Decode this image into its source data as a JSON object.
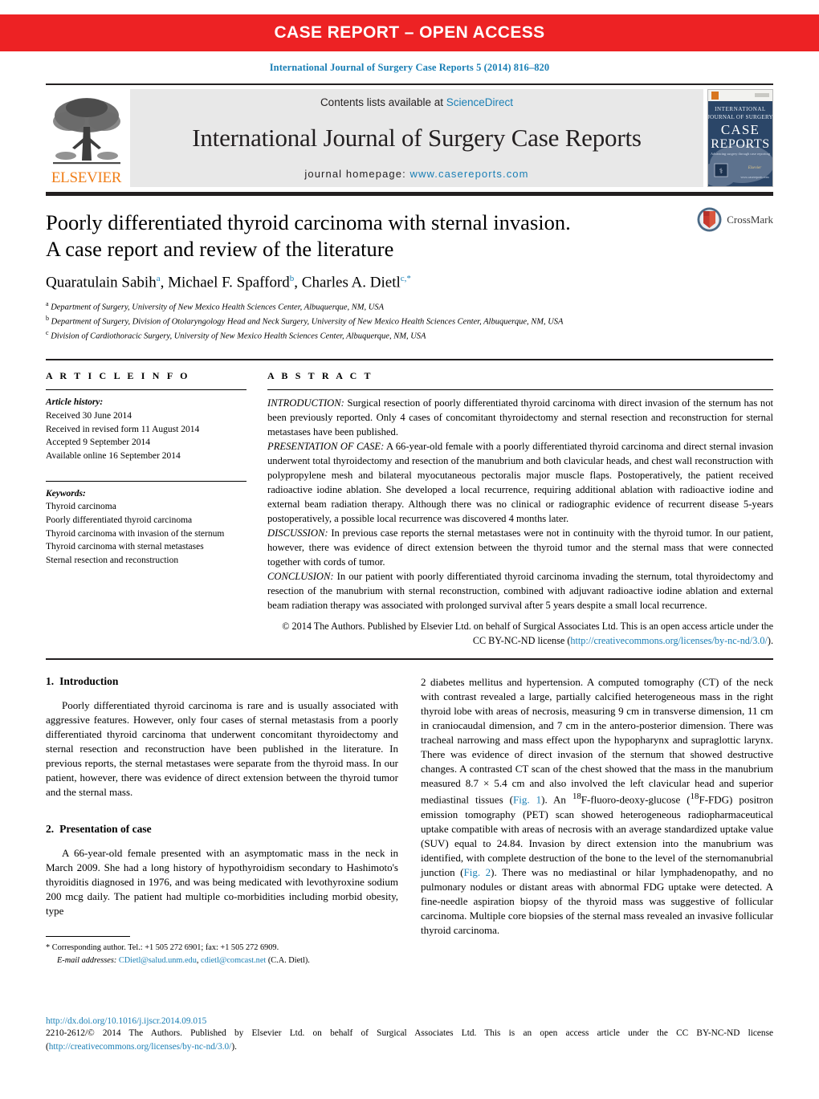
{
  "banner": {
    "text": "CASE REPORT – OPEN ACCESS"
  },
  "citation": {
    "text": "International Journal of Surgery Case Reports 5 (2014) 816–820"
  },
  "masthead": {
    "publisher_logo_text": "ELSEVIER",
    "contents_prefix": "Contents lists available at ",
    "contents_link": "ScienceDirect",
    "journal_title": "International Journal of Surgery Case Reports",
    "homepage_label": "journal homepage:",
    "homepage_url": "www.casereports.com",
    "cover": {
      "line1": "INTERNATIONAL",
      "line2": "JOURNAL OF SURGERY",
      "line3": "CASE",
      "line4": "REPORTS",
      "tagline": "Advancing surgery through case reporting",
      "url": "www.casereports.com"
    }
  },
  "article": {
    "title": "Poorly differentiated thyroid carcinoma with sternal invasion. A case report and review of the literature",
    "title_line1": "Poorly differentiated thyroid carcinoma with sternal invasion.",
    "title_line2": "A case report and review of the literature",
    "authors": [
      {
        "name": "Quaratulain Sabih",
        "marks": "a"
      },
      {
        "name": "Michael F. Spafford",
        "marks": "b"
      },
      {
        "name": "Charles A. Dietl",
        "marks": "c,*"
      }
    ],
    "affiliations": [
      {
        "mark": "a",
        "text": "Department of Surgery, University of New Mexico Health Sciences Center, Albuquerque, NM, USA"
      },
      {
        "mark": "b",
        "text": "Department of Surgery, Division of Otolaryngology Head and Neck Surgery, University of New Mexico Health Sciences Center, Albuquerque, NM, USA"
      },
      {
        "mark": "c",
        "text": "Division of Cardiothoracic Surgery, University of New Mexico Health Sciences Center, Albuquerque, NM, USA"
      }
    ],
    "crossmark_label": "CrossMark"
  },
  "info": {
    "heading": "A R T I C L E   I N F O",
    "history_label": "Article history:",
    "history": [
      "Received 30 June 2014",
      "Received in revised form 11 August 2014",
      "Accepted 9 September 2014",
      "Available online 16 September 2014"
    ],
    "keywords_label": "Keywords:",
    "keywords": [
      "Thyroid carcinoma",
      "Poorly differentiated thyroid carcinoma",
      "Thyroid carcinoma with invasion of the sternum",
      "Thyroid carcinoma with sternal metastases",
      "Sternal resection and reconstruction"
    ]
  },
  "abstract": {
    "heading": "A B S T R A C T",
    "sections": [
      {
        "lead": "INTRODUCTION:",
        "text": " Surgical resection of poorly differentiated thyroid carcinoma with direct invasion of the sternum has not been previously reported. Only 4 cases of concomitant thyroidectomy and sternal resection and reconstruction for sternal metastases have been published."
      },
      {
        "lead": "PRESENTATION OF CASE:",
        "text": " A 66-year-old female with a poorly differentiated thyroid carcinoma and direct sternal invasion underwent total thyroidectomy and resection of the manubrium and both clavicular heads, and chest wall reconstruction with polypropylene mesh and bilateral myocutaneous pectoralis major muscle flaps. Postoperatively, the patient received radioactive iodine ablation. She developed a local recurrence, requiring additional ablation with radioactive iodine and external beam radiation therapy. Although there was no clinical or radiographic evidence of recurrent disease 5-years postoperatively, a possible local recurrence was discovered 4 months later."
      },
      {
        "lead": "DISCUSSION:",
        "text": " In previous case reports the sternal metastases were not in continuity with the thyroid tumor. In our patient, however, there was evidence of direct extension between the thyroid tumor and the sternal mass that were connected together with cords of tumor."
      },
      {
        "lead": "CONCLUSION:",
        "text": " In our patient with poorly differentiated thyroid carcinoma invading the sternum, total thyroidectomy and resection of the manubrium with sternal reconstruction, combined with adjuvant radioactive iodine ablation and external beam radiation therapy was associated with prolonged survival after 5 years despite a small local recurrence."
      }
    ],
    "copyright_text": "© 2014 The Authors. Published by Elsevier Ltd. on behalf of Surgical Associates Ltd. This is an open access article under the CC BY-NC-ND license (",
    "copyright_link": "http://creativecommons.org/licenses/by-nc-nd/3.0/",
    "copyright_tail": ")."
  },
  "body": {
    "left": {
      "section1_num": "1.",
      "section1_title": "Introduction",
      "section1_para": "Poorly differentiated thyroid carcinoma is rare and is usually associated with aggressive features. However, only four cases of sternal metastasis from a poorly differentiated thyroid carcinoma that underwent concomitant thyroidectomy and sternal resection and reconstruction have been published in the literature. In previous reports, the sternal metastases were separate from the thyroid mass. In our patient, however, there was evidence of direct extension between the thyroid tumor and the sternal mass.",
      "section2_num": "2.",
      "section2_title": "Presentation of case",
      "section2_para": "A 66-year-old female presented with an asymptomatic mass in the neck in March 2009. She had a long history of hypothyroidism secondary to Hashimoto's thyroiditis diagnosed in 1976, and was being medicated with levothyroxine sodium 200 mcg daily. The patient had multiple co-morbidities including morbid obesity, type"
    },
    "right": {
      "para_part1": "2 diabetes mellitus and hypertension. A computed tomography (CT) of the neck with contrast revealed a large, partially calcified heterogeneous mass in the right thyroid lobe with areas of necrosis, measuring 9 cm in transverse dimension, 11 cm in craniocaudal dimension, and 7 cm in the antero-posterior dimension. There was tracheal narrowing and mass effect upon the hypopharynx and supraglottic larynx. There was evidence of direct invasion of the sternum that showed destructive changes. A contrasted CT scan of the chest showed that the mass in the manubrium measured 8.7 × 5.4 cm and also involved the left clavicular head and superior mediastinal tissues (",
      "fig1_ref": "Fig. 1",
      "para_part2": "). An ",
      "sup18_a": "18",
      "para_part3": "F-fluoro-deoxy-glucose (",
      "sup18_b": "18",
      "para_part4": "F-FDG) positron emission tomography (PET) scan showed heterogeneous radiopharmaceutical uptake compatible with areas of necrosis with an average standardized uptake value (SUV) equal to 24.84. Invasion by direct extension into the manubrium was identified, with complete destruction of the bone to the level of the sternomanubrial junction (",
      "fig2_ref": "Fig. 2",
      "para_part5": "). There was no mediastinal or hilar lymphadenopathy, and no pulmonary nodules or distant areas with abnormal FDG uptake were detected. A fine-needle aspiration biopsy of the thyroid mass was suggestive of follicular carcinoma. Multiple core biopsies of the sternal mass revealed an invasive follicular thyroid carcinoma."
    }
  },
  "footnote": {
    "star": "*",
    "corresponding": "Corresponding author. Tel.: +1 505 272 6901; fax: +1 505 272 6909.",
    "email_label": "E-mail addresses:",
    "email1": "CDietl@salud.unm.edu",
    "email_sep": ", ",
    "email2": "cdietl@comcast.net",
    "email_tail": " (C.A. Dietl)."
  },
  "page_footer": {
    "doi": "http://dx.doi.org/10.1016/j.ijscr.2014.09.015",
    "text_before": "2210-2612/© 2014 The Authors. Published by Elsevier Ltd. on behalf of Surgical Associates Ltd. This is an open access article under the CC BY-NC-ND license (",
    "license_link": "http://creativecommons.org/licenses/by-nc-nd/3.0/",
    "text_after": ")."
  },
  "colors": {
    "banner_red": "#ED2224",
    "link_blue": "#1A7FB5",
    "elsevier_orange": "#F07F1A",
    "masthead_grey": "#E8E8E8"
  }
}
